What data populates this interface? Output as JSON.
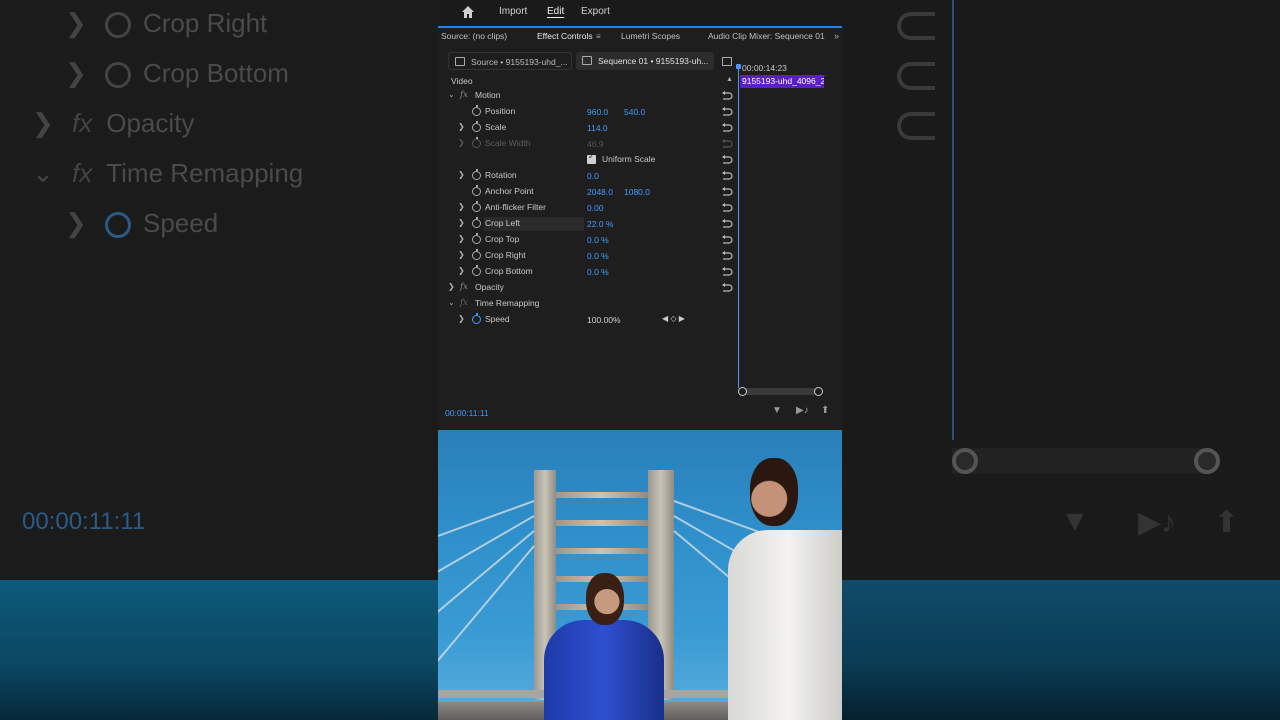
{
  "menu": {
    "import": "Import",
    "edit": "Edit",
    "export": "Export"
  },
  "panel_tabs": {
    "source": "Source: (no clips)",
    "effect_controls": "Effect Controls",
    "lumetri": "Lumetri Scopes",
    "audio_mixer": "Audio Clip Mixer: Sequence 01"
  },
  "subtabs": {
    "source": "Source • 9155193-uhd_...",
    "sequence": "Sequence 01 • 9155193-uh..."
  },
  "section": "Video",
  "rows": [
    {
      "label": "Motion"
    },
    {
      "label": "Position",
      "v1": "960.0",
      "v2": "540.0"
    },
    {
      "label": "Scale",
      "v1": "114.0"
    },
    {
      "label": "Scale Width",
      "v1": "46.9"
    },
    {
      "label": "Uniform Scale"
    },
    {
      "label": "Rotation",
      "v1": "0.0"
    },
    {
      "label": "Anchor Point",
      "v1": "2048.0",
      "v2": "1080.0"
    },
    {
      "label": "Anti-flicker Filter",
      "v1": "0.00"
    },
    {
      "label": "Crop Left",
      "v1": "22.0 %"
    },
    {
      "label": "Crop Top",
      "v1": "0.0 %"
    },
    {
      "label": "Crop Right",
      "v1": "0.0 %"
    },
    {
      "label": "Crop Bottom",
      "v1": "0.0 %"
    },
    {
      "label": "Opacity"
    },
    {
      "label": "Time Remapping"
    },
    {
      "label": "Speed",
      "v1": "100.00%"
    }
  ],
  "timeline": {
    "time": "00:00:14:23",
    "clip": "9155193-uhd_4096_2"
  },
  "current_time": "00:00:11:11",
  "background": {
    "rows": [
      "Crop Right",
      "Crop Bottom",
      "Opacity",
      "Time Remapping",
      "Speed"
    ],
    "time": "00:00:11:11"
  }
}
